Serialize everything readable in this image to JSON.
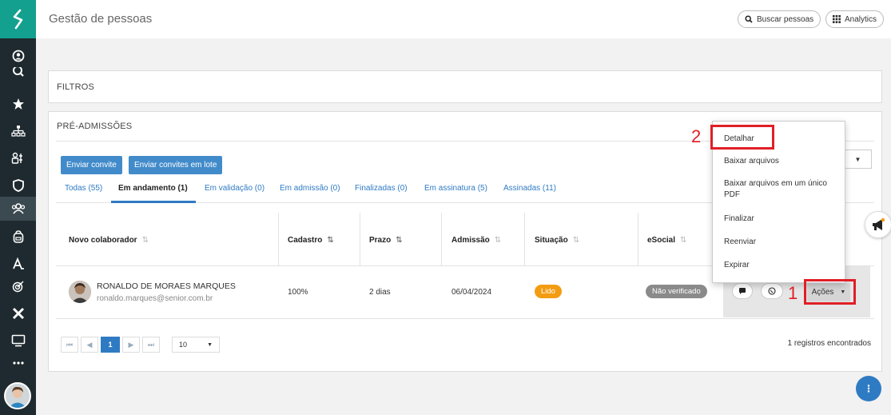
{
  "header": {
    "title": "Gestão de pessoas",
    "search_people": "Buscar pessoas",
    "analytics": "Analytics"
  },
  "filters": {
    "title": "FILTROS"
  },
  "preadm": {
    "title": "PRÉ-ADMISSÕES",
    "send_invite": "Enviar convite",
    "send_batch": "Enviar convites em lote",
    "tabs": [
      {
        "label": "Todas (55)"
      },
      {
        "label": "Em andamento (1)"
      },
      {
        "label": "Em validação (0)"
      },
      {
        "label": "Em admissão (0)"
      },
      {
        "label": "Finalizadas (0)"
      },
      {
        "label": "Em assinatura (5)"
      },
      {
        "label": "Assinadas (11)"
      }
    ],
    "columns": {
      "colab": "Novo colaborador",
      "cadastro": "Cadastro",
      "prazo": "Prazo",
      "admissao": "Admissão",
      "situacao": "Situação",
      "esocial": "eSocial"
    },
    "row": {
      "name": "RONALDO DE MORAES MARQUES",
      "email": "ronaldo.marques@senior.com.br",
      "cadastro": "100%",
      "prazo": "2 dias",
      "admissao": "06/04/2024",
      "situacao": "Lido",
      "esocial": "Não verificado",
      "acoes": "Ações"
    },
    "pagination": {
      "current_page": "1",
      "page_size": "10",
      "found": "1 registros encontrados"
    }
  },
  "dropdown": {
    "items": [
      "Detalhar",
      "Baixar arquivos",
      "Baixar arquivos em um único PDF",
      "Finalizar",
      "Reenviar",
      "Expirar"
    ]
  },
  "annotations": {
    "step1": "1",
    "step2": "2"
  },
  "colors": {
    "brand": "#13a08f",
    "sidebar": "#1e2a2f",
    "primary": "#428bca",
    "badge_lido": "#f39c12",
    "badge_esocial": "#8a8a8a",
    "annotation": "#e01f26"
  }
}
